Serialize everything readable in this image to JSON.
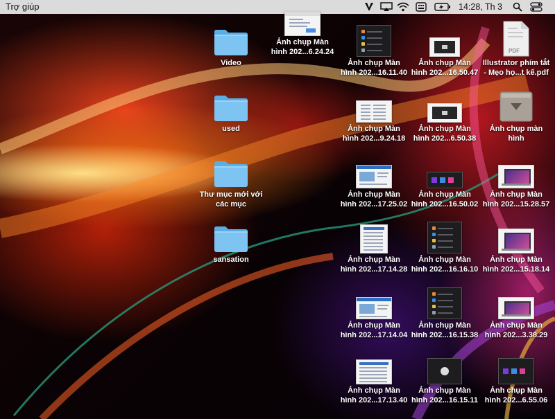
{
  "menubar": {
    "app_menu": "Trợ giúp",
    "clock": "14:28, Th 3",
    "icons": [
      "vectorize-icon",
      "airplay-icon",
      "wifi-icon",
      "keyboard-input-icon",
      "battery-charging-icon",
      "search-icon",
      "control-center-icon"
    ]
  },
  "desktop": {
    "items": [
      {
        "label": "Video",
        "kind": "folder"
      },
      {
        "label": "used",
        "kind": "folder"
      },
      {
        "label": "Thư mục mới với\ncác mục",
        "kind": "folder"
      },
      {
        "label": "sansation",
        "kind": "folder"
      },
      {
        "label": "Ảnh chụp Màn\nhình 202...6.24.24",
        "kind": "screenshot"
      },
      {
        "label": "Ảnh chụp Màn\nhình 202...16.11.40",
        "kind": "screenshot"
      },
      {
        "label": "Ảnh chụp Màn\nhình 202...16.50.47",
        "kind": "screenshot"
      },
      {
        "label": "Illustrator phím tắt\n- Mẹo họ...t kế.pdf",
        "kind": "pdf",
        "badge": "PDF"
      },
      {
        "label": "Ảnh chụp Màn\nhình 202...9.24.18",
        "kind": "screenshot"
      },
      {
        "label": "Ảnh chụp Màn\nhình 202...6.50.38",
        "kind": "screenshot"
      },
      {
        "label": "Ảnh chụp màn\nhình",
        "kind": "disk-image"
      },
      {
        "label": "Ảnh chụp Màn\nhình 202...17.25.02",
        "kind": "screenshot"
      },
      {
        "label": "Ảnh chụp Màn\nhình 202...16.50.02",
        "kind": "screenshot"
      },
      {
        "label": "Ảnh chụp Màn\nhình 202...15.28.57",
        "kind": "screenshot"
      },
      {
        "label": "Ảnh chụp Màn\nhình 202...17.14.28",
        "kind": "screenshot"
      },
      {
        "label": "Ảnh chụp Màn\nhình 202...16.16.10",
        "kind": "screenshot"
      },
      {
        "label": "Ảnh chụp Màn\nhình 202...15.18.14",
        "kind": "screenshot"
      },
      {
        "label": "Ảnh chụp Màn\nhình 202...17.14.04",
        "kind": "screenshot"
      },
      {
        "label": "Ảnh chụp Màn\nhình 202...16.15.38",
        "kind": "screenshot"
      },
      {
        "label": "Ảnh chụp Màn\nhình 202...3.38.29",
        "kind": "screenshot"
      },
      {
        "label": "Ảnh chụp Màn\nhình 202...17.13.40",
        "kind": "screenshot"
      },
      {
        "label": "Ảnh chụp Màn\nhình 202...16.15.11",
        "kind": "screenshot"
      },
      {
        "label": "Ảnh chụp Màn\nhình 202...6.55.06",
        "kind": "screenshot"
      }
    ]
  }
}
